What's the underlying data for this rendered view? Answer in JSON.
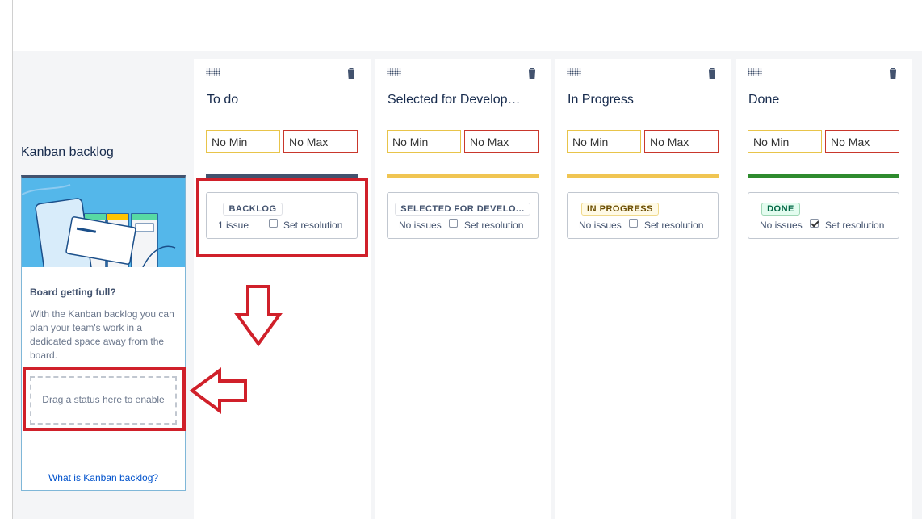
{
  "kanban_backlog": {
    "heading": "Kanban backlog",
    "question": "Board getting full?",
    "description": "With the Kanban backlog you can plan your team's work in a dedicated space away from the board.",
    "drop_zone": "Drag a status here to enable",
    "link": "What is Kanban backlog?"
  },
  "columns": [
    {
      "title": "To do",
      "min": "No Min",
      "max": "No Max",
      "bar_color": "#42526e",
      "status": {
        "label": "BACKLOG",
        "count": "1 issue",
        "resolution": "Set resolution",
        "checked": false
      }
    },
    {
      "title": "Selected for Development",
      "min": "No Min",
      "max": "No Max",
      "bar_color": "#f0c552",
      "status": {
        "label": "SELECTED FOR DEVELO...",
        "count": "No issues",
        "resolution": "Set resolution",
        "checked": false
      }
    },
    {
      "title": "In Progress",
      "min": "No Min",
      "max": "No Max",
      "bar_color": "#f0c552",
      "status": {
        "label": "IN PROGRESS",
        "count": "No issues",
        "resolution": "Set resolution",
        "checked": false
      }
    },
    {
      "title": "Done",
      "min": "No Min",
      "max": "No Max",
      "bar_color": "#2e8b2e",
      "status": {
        "label": "DONE",
        "count": "No issues",
        "resolution": "Set resolution",
        "checked": true
      }
    }
  ],
  "colors": {
    "highlight": "#d0202a",
    "link": "#0052cc"
  }
}
